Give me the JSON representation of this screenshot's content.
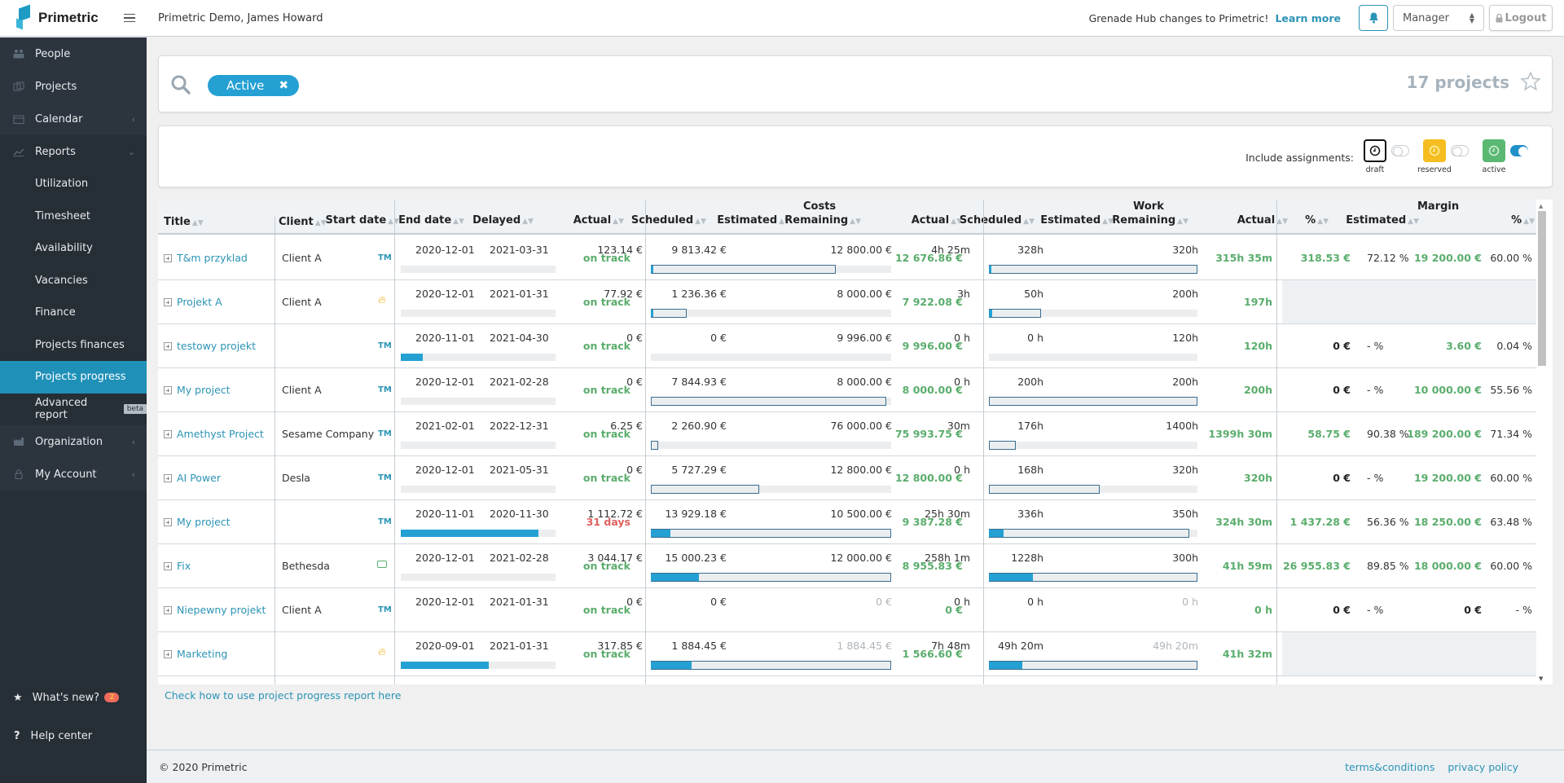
{
  "app": {
    "brand": "Primetric",
    "company_user": "Primetric Demo, James Howard",
    "announcement": "Grenade Hub changes to Primetric!",
    "learn_more": "Learn more",
    "role": "Manager",
    "logout": "Logout"
  },
  "sidebar": {
    "items": [
      {
        "label": "People",
        "icon": "people-icon"
      },
      {
        "label": "Projects",
        "icon": "projects-icon"
      },
      {
        "label": "Calendar",
        "icon": "calendar-icon"
      },
      {
        "label": "Reports",
        "icon": "chart-icon"
      }
    ],
    "report_items": [
      {
        "label": "Utilization"
      },
      {
        "label": "Timesheet"
      },
      {
        "label": "Availability"
      },
      {
        "label": "Vacancies"
      },
      {
        "label": "Finance"
      },
      {
        "label": "Projects finances"
      },
      {
        "label": "Projects progress",
        "active": true
      },
      {
        "label": "Advanced report",
        "badge": "beta"
      }
    ],
    "bottom_items": [
      {
        "label": "Organization",
        "icon": "organization-icon"
      },
      {
        "label": "My Account",
        "icon": "lock-icon"
      }
    ],
    "whats_new": "What's new?",
    "whats_new_count": "2",
    "help_center": "Help center"
  },
  "search": {
    "filter_chip": "Active",
    "projects_count": "17 projects"
  },
  "assignments": {
    "label": "Include assignments:",
    "types": [
      {
        "label": "draft",
        "color": "#ffffff",
        "enabled": false
      },
      {
        "label": "reserved",
        "color": "#f5bd1f",
        "enabled": false
      },
      {
        "label": "active",
        "color": "#5ab872",
        "enabled": true
      }
    ]
  },
  "table": {
    "groups": {
      "costs": "Costs",
      "work": "Work",
      "margin": "Margin"
    },
    "headers": {
      "title": "Title",
      "client": "Client",
      "start": "Start date",
      "end": "End date",
      "delayed": "Delayed",
      "c_actual": "Actual",
      "c_scheduled": "Scheduled",
      "c_estimated": "Estimated",
      "c_remaining": "Remaining",
      "w_actual": "Actual",
      "w_scheduled": "Scheduled",
      "w_estimated": "Estimated",
      "w_remaining": "Remaining",
      "m_actual": "Actual",
      "m_pct": "%",
      "m_estimated": "Estimated",
      "m_est_pct": "%"
    },
    "rows": [
      {
        "title": "T&m przyklad",
        "client": "Client A",
        "type": "TM",
        "start": "2020-12-01",
        "end": "2021-03-31",
        "delayed": "on track",
        "time_progress": 0,
        "c_actual": "123.14 €",
        "c_scheduled": "9 813.42 €",
        "c_estimated": "12 800.00 €",
        "c_remaining": "12 676.86 €",
        "c_actual_pct": 0.01,
        "c_sched_pct": 0.77,
        "w_actual": "4h 25m",
        "w_scheduled": "328h",
        "w_estimated": "320h",
        "w_remaining": "315h 35m",
        "w_actual_pct": 0.01,
        "w_sched_pct": 1.0,
        "m_actual": "318.53 €",
        "m_pct": "72.12 %",
        "m_estimated": "19 200.00 €",
        "m_est_pct": "60.00 %"
      },
      {
        "title": "Projekt A",
        "client": "Client A",
        "type": "FIXED",
        "start": "2020-12-01",
        "end": "2021-01-31",
        "delayed": "on track",
        "time_progress": 0,
        "c_actual": "77.92 €",
        "c_scheduled": "1 236.36 €",
        "c_estimated": "8 000.00 €",
        "c_remaining": "7 922.08 €",
        "c_actual_pct": 0.01,
        "c_sched_pct": 0.15,
        "w_actual": "3h",
        "w_scheduled": "50h",
        "w_estimated": "200h",
        "w_remaining": "197h",
        "w_actual_pct": 0.015,
        "w_sched_pct": 0.25,
        "m_actual": "",
        "m_pct": "",
        "m_estimated": "",
        "m_est_pct": ""
      },
      {
        "title": "testowy projekt",
        "client": "",
        "type": "TM",
        "start": "2020-11-01",
        "end": "2021-04-30",
        "delayed": "on track",
        "time_progress": 0.14,
        "c_actual": "0 €",
        "c_scheduled": "0 €",
        "c_estimated": "9 996.00 €",
        "c_remaining": "9 996.00 €",
        "c_actual_pct": 0,
        "c_sched_pct": 0,
        "w_actual": "0 h",
        "w_scheduled": "0 h",
        "w_estimated": "120h",
        "w_remaining": "120h",
        "w_actual_pct": 0,
        "w_sched_pct": 0,
        "m_actual": "0 €",
        "m_pct": "- %",
        "m_estimated": "3.60 €",
        "m_est_pct": "0.04 %"
      },
      {
        "title": "My project",
        "client": "Client A",
        "type": "TM",
        "start": "2020-12-01",
        "end": "2021-02-28",
        "delayed": "on track",
        "time_progress": 0,
        "c_actual": "0 €",
        "c_scheduled": "7 844.93 €",
        "c_estimated": "8 000.00 €",
        "c_remaining": "8 000.00 €",
        "c_actual_pct": 0,
        "c_sched_pct": 0.98,
        "w_actual": "0 h",
        "w_scheduled": "200h",
        "w_estimated": "200h",
        "w_remaining": "200h",
        "w_actual_pct": 0,
        "w_sched_pct": 1.0,
        "m_actual": "0 €",
        "m_pct": "- %",
        "m_estimated": "10 000.00 €",
        "m_est_pct": "55.56 %"
      },
      {
        "title": "Amethyst Project",
        "client": "Sesame Company",
        "type": "TM",
        "start": "2021-02-01",
        "end": "2022-12-31",
        "delayed": "on track",
        "time_progress": 0,
        "c_actual": "6.25 €",
        "c_scheduled": "2 260.90 €",
        "c_estimated": "76 000.00 €",
        "c_remaining": "75 993.75 €",
        "c_actual_pct": 0,
        "c_sched_pct": 0.03,
        "w_actual": "30m",
        "w_scheduled": "176h",
        "w_estimated": "1400h",
        "w_remaining": "1399h 30m",
        "w_actual_pct": 0,
        "w_sched_pct": 0.13,
        "m_actual": "58.75 €",
        "m_pct": "90.38 %",
        "m_estimated": "189 200.00 €",
        "m_est_pct": "71.34 %"
      },
      {
        "title": "AI Power",
        "client": "Desla",
        "type": "TM",
        "start": "2020-12-01",
        "end": "2021-05-31",
        "delayed": "on track",
        "time_progress": 0,
        "c_actual": "0 €",
        "c_scheduled": "5 727.29 €",
        "c_estimated": "12 800.00 €",
        "c_remaining": "12 800.00 €",
        "c_actual_pct": 0,
        "c_sched_pct": 0.45,
        "w_actual": "0 h",
        "w_scheduled": "168h",
        "w_estimated": "320h",
        "w_remaining": "320h",
        "w_actual_pct": 0,
        "w_sched_pct": 0.53,
        "m_actual": "0 €",
        "m_pct": "- %",
        "m_estimated": "19 200.00 €",
        "m_est_pct": "60.00 %"
      },
      {
        "title": "My project",
        "client": "",
        "type": "TM",
        "start": "2020-11-01",
        "end": "2020-11-30",
        "delayed": "31 days",
        "time_progress": 0.89,
        "c_actual": "1 112.72 €",
        "c_scheduled": "13 929.18 €",
        "c_estimated": "10 500.00 €",
        "c_remaining": "9 387.28 €",
        "c_actual_pct": 0.08,
        "c_sched_pct": 1.0,
        "w_actual": "25h 30m",
        "w_scheduled": "336h",
        "w_estimated": "350h",
        "w_remaining": "324h 30m",
        "w_actual_pct": 0.07,
        "w_sched_pct": 0.96,
        "m_actual": "1 437.28 €",
        "m_pct": "56.36 %",
        "m_estimated": "18 250.00 €",
        "m_est_pct": "63.48 %"
      },
      {
        "title": "Fix",
        "client": "Bethesda",
        "type": "FIXED_PRICE",
        "start": "2020-12-01",
        "end": "2021-02-28",
        "delayed": "on track",
        "time_progress": 0,
        "c_actual": "3 044.17 €",
        "c_scheduled": "15 000.23 €",
        "c_estimated": "12 000.00 €",
        "c_remaining": "8 955.83 €",
        "c_actual_pct": 0.2,
        "c_sched_pct": 1.0,
        "w_actual": "258h 1m",
        "w_scheduled": "1228h",
        "w_estimated": "300h",
        "w_remaining": "41h 59m",
        "w_actual_pct": 0.21,
        "w_sched_pct": 1.0,
        "m_actual": "26 955.83 €",
        "m_pct": "89.85 %",
        "m_estimated": "18 000.00 €",
        "m_est_pct": "60.00 %"
      },
      {
        "title": "Niepewny projekt",
        "client": "Client A",
        "type": "TM",
        "start": "2020-12-01",
        "end": "2021-01-31",
        "delayed": "on track",
        "time_progress": null,
        "c_actual": "0 €",
        "c_scheduled": "0 €",
        "c_estimated": "0 €",
        "c_remaining": "0 €",
        "c_actual_pct": null,
        "c_sched_pct": null,
        "c_est_muted": true,
        "w_actual": "0 h",
        "w_scheduled": "0 h",
        "w_estimated": "0 h",
        "w_remaining": "0 h",
        "w_actual_pct": null,
        "w_sched_pct": null,
        "w_est_muted": true,
        "m_actual": "0 €",
        "m_pct": "- %",
        "m_estimated": "0 €",
        "m_est_pct": "- %",
        "m_est_bold": true
      },
      {
        "title": "Marketing",
        "client": "",
        "type": "FIXED",
        "start": "2020-09-01",
        "end": "2021-01-31",
        "delayed": "on track",
        "time_progress": 0.57,
        "c_actual": "317.85 €",
        "c_scheduled": "1 884.45 €",
        "c_estimated": "1 884.45 €",
        "c_remaining": "1 566.60 €",
        "c_actual_pct": 0.17,
        "c_sched_pct": 1.0,
        "c_est_muted": true,
        "w_actual": "7h 48m",
        "w_scheduled": "49h 20m",
        "w_estimated": "49h 20m",
        "w_remaining": "41h 32m",
        "w_actual_pct": 0.16,
        "w_sched_pct": 1.0,
        "w_est_muted": true,
        "m_actual": "",
        "m_pct": "",
        "m_estimated": "",
        "m_est_pct": ""
      }
    ]
  },
  "help_link": "Check how to use project progress report here",
  "footer": {
    "copyright": "© 2020 Primetric",
    "terms": "terms&conditions",
    "privacy": "privacy policy"
  }
}
